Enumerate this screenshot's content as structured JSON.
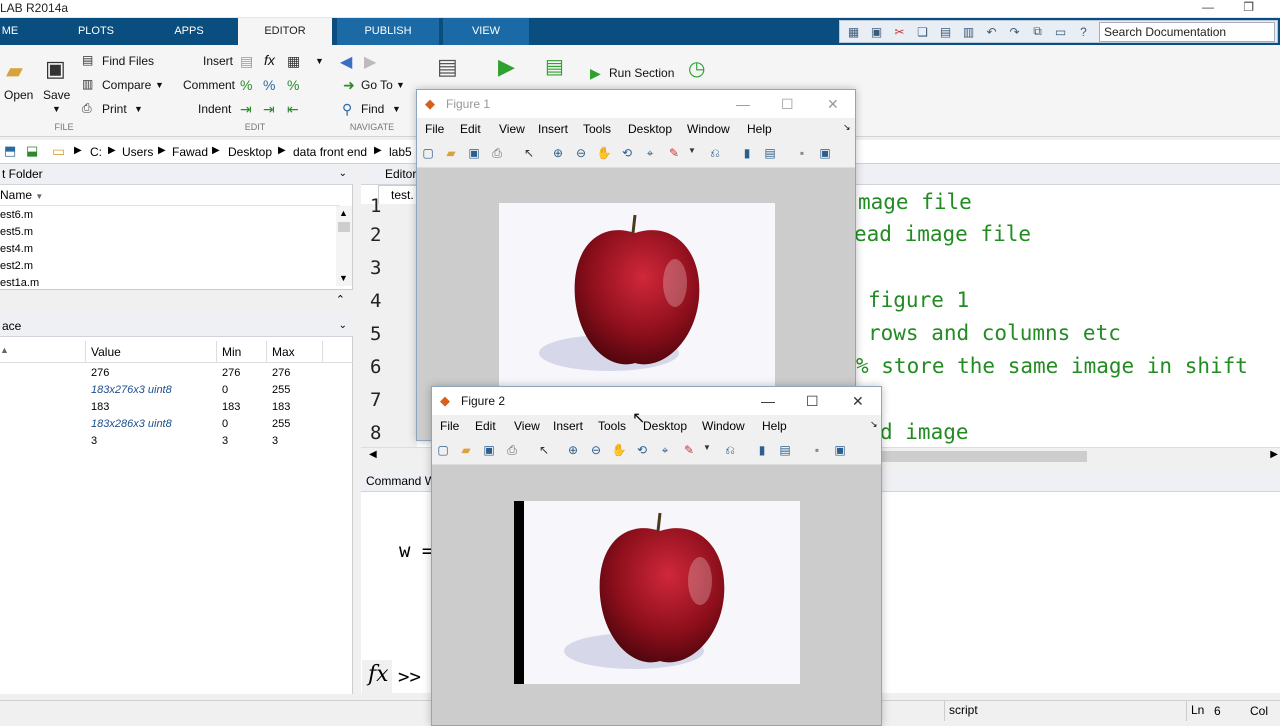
{
  "app": {
    "title": "LAB R2014a"
  },
  "tabs": [
    "ME",
    "PLOTS",
    "APPS",
    "EDITOR",
    "PUBLISH",
    "VIEW"
  ],
  "search": {
    "placeholder": "Search Documentation"
  },
  "ribbon": {
    "open": "Open",
    "save": "Save",
    "find_files": "Find Files",
    "compare": "Compare",
    "print": "Print",
    "insert": "Insert",
    "comment": "Comment",
    "indent": "Indent",
    "fx": "fx",
    "go_to": "Go To",
    "find": "Find",
    "run_section": "Run Section",
    "sections": [
      "FILE",
      "EDIT",
      "NAVIGATE"
    ]
  },
  "address": {
    "crumbs": [
      "C:",
      "Users",
      "Fawad",
      "Desktop",
      "data front end",
      "lab5"
    ]
  },
  "current_folder": {
    "title": "t Folder",
    "col_name": "Name",
    "files": [
      "est6.m",
      "est5.m",
      "est4.m",
      "est2.m",
      "est1a.m"
    ]
  },
  "workspace": {
    "title": "ace",
    "cols": [
      "Value",
      "Min",
      "Max"
    ],
    "rows": [
      {
        "value": "276",
        "min": "276",
        "max": "276",
        "italic": false
      },
      {
        "value": "183x276x3 uint8",
        "min": "0",
        "max": "255",
        "italic": true
      },
      {
        "value": "183",
        "min": "183",
        "max": "183",
        "italic": false
      },
      {
        "value": "183x286x3 uint8",
        "min": "0",
        "max": "255",
        "italic": true
      },
      {
        "value": "3",
        "min": "3",
        "max": "3",
        "italic": false
      }
    ]
  },
  "editor": {
    "title": "Editor",
    "file_tab": "test.",
    "line_numbers": [
      "1",
      "2",
      "3",
      "4",
      "5",
      "6",
      "7",
      "8"
    ],
    "code_lines": [
      "mage file",
      "ead image file",
      "figure 1",
      "rows and columns etc",
      "% store the same image in shift",
      "d image"
    ]
  },
  "command_window": {
    "title": "Command W",
    "output": "w =",
    "prompt": ">>",
    "fx": "fx"
  },
  "status": {
    "mode": "script",
    "ln_label": "Ln",
    "ln": "6",
    "col_label": "Col"
  },
  "figure1": {
    "title": "Figure 1",
    "menu": [
      "File",
      "Edit",
      "View",
      "Insert",
      "Tools",
      "Desktop",
      "Window",
      "Help"
    ]
  },
  "figure2": {
    "title": "Figure 2",
    "menu": [
      "File",
      "Edit",
      "View",
      "Insert",
      "Tools",
      "Desktop",
      "Window",
      "Help"
    ]
  }
}
